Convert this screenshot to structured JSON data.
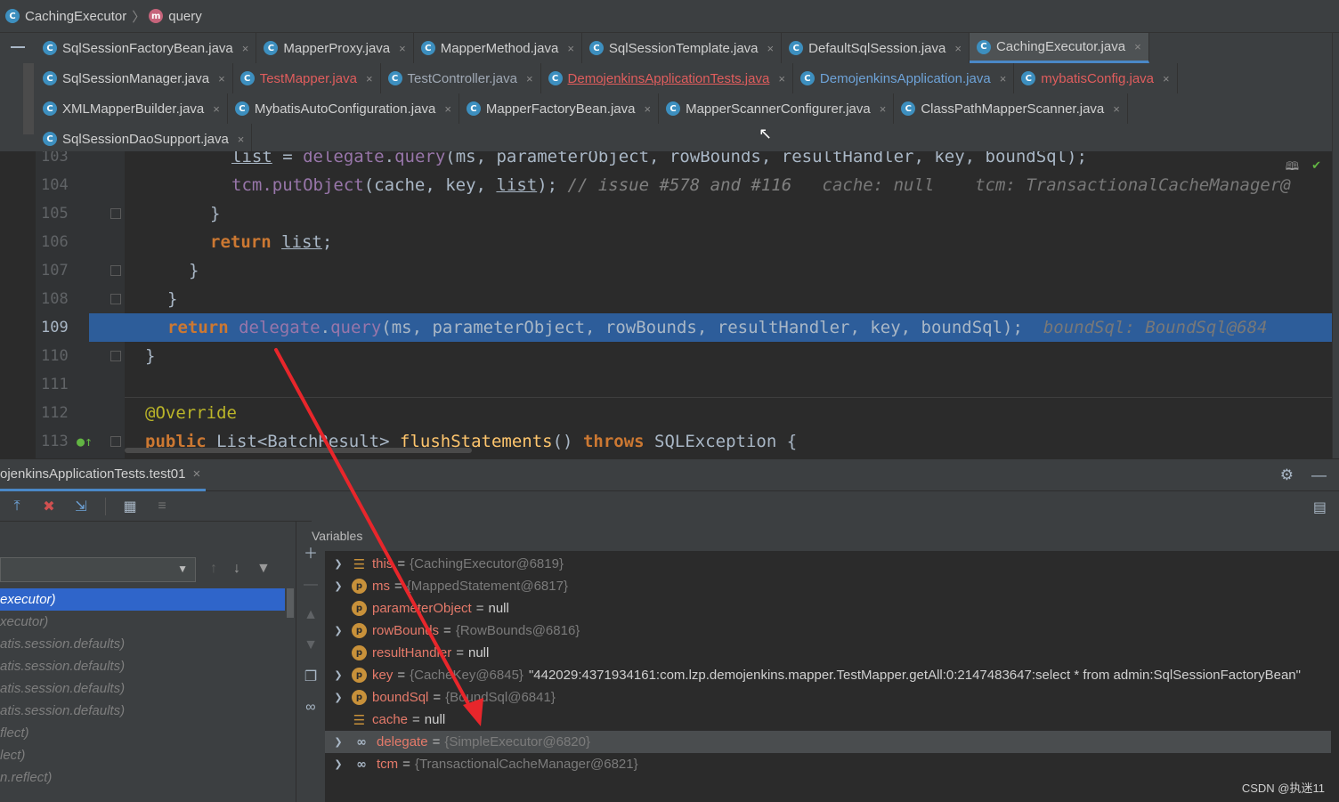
{
  "breadcrumb": {
    "class_name": "CachingExecutor",
    "method_name": "query"
  },
  "tabs": {
    "row1": [
      {
        "label": "SqlSessionFactoryBean.java",
        "style": "normal"
      },
      {
        "label": "MapperProxy.java",
        "style": "normal"
      },
      {
        "label": "MapperMethod.java",
        "style": "normal"
      },
      {
        "label": "SqlSessionTemplate.java",
        "style": "normal"
      },
      {
        "label": "DefaultSqlSession.java",
        "style": "normal"
      },
      {
        "label": "CachingExecutor.java",
        "style": "active"
      }
    ],
    "row2": [
      {
        "label": "SqlSessionManager.java",
        "style": "normal"
      },
      {
        "label": "TestMapper.java",
        "style": "red"
      },
      {
        "label": "TestController.java",
        "style": "gray"
      },
      {
        "label": "DemojenkinsApplicationTests.java",
        "style": "redu"
      },
      {
        "label": "DemojenkinsApplication.java",
        "style": "blu"
      },
      {
        "label": "mybatisConfig.java",
        "style": "red"
      }
    ],
    "row3": [
      {
        "label": "XMLMapperBuilder.java",
        "style": "normal"
      },
      {
        "label": "MybatisAutoConfiguration.java",
        "style": "normal"
      },
      {
        "label": "MapperFactoryBean.java",
        "style": "normal"
      },
      {
        "label": "MapperScannerConfigurer.java",
        "style": "normal"
      },
      {
        "label": "ClassPathMapperScanner.java",
        "style": "normal"
      }
    ],
    "row4": [
      {
        "label": "SqlSessionDaoSupport.java",
        "style": "normal"
      }
    ],
    "close_glyph": "×"
  },
  "editor": {
    "lines": [
      {
        "num": "103"
      },
      {
        "num": "104"
      },
      {
        "num": "105"
      },
      {
        "num": "106"
      },
      {
        "num": "107"
      },
      {
        "num": "108"
      },
      {
        "num": "109"
      },
      {
        "num": "110"
      },
      {
        "num": "111"
      },
      {
        "num": "112"
      },
      {
        "num": "113"
      }
    ],
    "code": {
      "l103_list": "list",
      "l103_rest_a": " = ",
      "l103_delegate": "delegate",
      "l103_dot": ".",
      "l103_query": "query",
      "l103_args": "(ms, parameterObject, rowBounds, resultHandler, key, boundSql);",
      "l104_tcm": "tcm",
      "l104_put": ".putObject",
      "l104_args_a": "(cache, key, ",
      "l104_list": "list",
      "l104_args_b": "); ",
      "l104_comment": "// issue #578 and #116",
      "l104_hint_a": "cache: null",
      "l104_hint_b": "tcm: TransactionalCacheManager@",
      "l105": "}",
      "l106_ret": "return",
      "l106_list": "list",
      "l106_semi": ";",
      "l107": "}",
      "l108": "}",
      "l109_ret": "return",
      "l109_delegate": "delegate",
      "l109_dot": ".",
      "l109_query": "query",
      "l109_args": "(ms, parameterObject, rowBounds, resultHandler, key, boundSql);",
      "l109_hint": "boundSql: BoundSql@684",
      "l110": "}",
      "l112_ann": "@Override",
      "l113_public": "public",
      "l113_type": "List<BatchResult>",
      "l113_method": "flushStatements",
      "l113_parens": "()",
      "l113_throws": "throws",
      "l113_exc": "SQLException",
      "l113_brace": "{"
    }
  },
  "debug": {
    "tab_label": "ojenkinsApplicationTests.test01",
    "variables_title": "Variables",
    "frames": [
      {
        "text": "executor)",
        "selected": true
      },
      {
        "text": "xecutor)",
        "selected": false
      },
      {
        "text": "atis.session.defaults)",
        "selected": false
      },
      {
        "text": "atis.session.defaults)",
        "selected": false
      },
      {
        "text": "atis.session.defaults)",
        "selected": false
      },
      {
        "text": "atis.session.defaults)",
        "selected": false
      },
      {
        "text": "flect)",
        "selected": false
      },
      {
        "text": "lect)",
        "selected": false
      },
      {
        "text": "n.reflect)",
        "selected": false
      }
    ],
    "variables": [
      {
        "expandable": true,
        "icon": "field",
        "name": "this",
        "value": "{CachingExecutor@6819}",
        "kind": "obj"
      },
      {
        "expandable": true,
        "icon": "param",
        "name": "ms",
        "value": "{MappedStatement@6817}",
        "kind": "obj"
      },
      {
        "expandable": false,
        "icon": "param",
        "name": "parameterObject",
        "value": "null",
        "kind": "null"
      },
      {
        "expandable": true,
        "icon": "param",
        "name": "rowBounds",
        "value": "{RowBounds@6816}",
        "kind": "obj"
      },
      {
        "expandable": false,
        "icon": "param",
        "name": "resultHandler",
        "value": "null",
        "kind": "null"
      },
      {
        "expandable": true,
        "icon": "param",
        "name": "key",
        "value": "{CacheKey@6845}",
        "kind": "obj",
        "str": "\"442029:4371934161:com.lzp.demojenkins.mapper.TestMapper.getAll:0:2147483647:select * from admin:SqlSessionFactoryBean\""
      },
      {
        "expandable": true,
        "icon": "param",
        "name": "boundSql",
        "value": "{BoundSql@6841}",
        "kind": "obj"
      },
      {
        "expandable": false,
        "icon": "field",
        "name": "cache",
        "value": "null",
        "kind": "null"
      },
      {
        "expandable": true,
        "icon": "watch",
        "name": "delegate",
        "value": "{SimpleExecutor@6820}",
        "kind": "obj",
        "selected": true
      },
      {
        "expandable": true,
        "icon": "watch",
        "name": "tcm",
        "value": "{TransactionalCacheManager@6821}",
        "kind": "obj"
      }
    ],
    "param_icon_letter": "p",
    "equals": "=",
    "watermark": "CSDN @执迷11"
  },
  "colors": {
    "annotation_arrow": "#e8262b",
    "selection": "#2f65ca",
    "execution_line": "#2d5d9a"
  }
}
